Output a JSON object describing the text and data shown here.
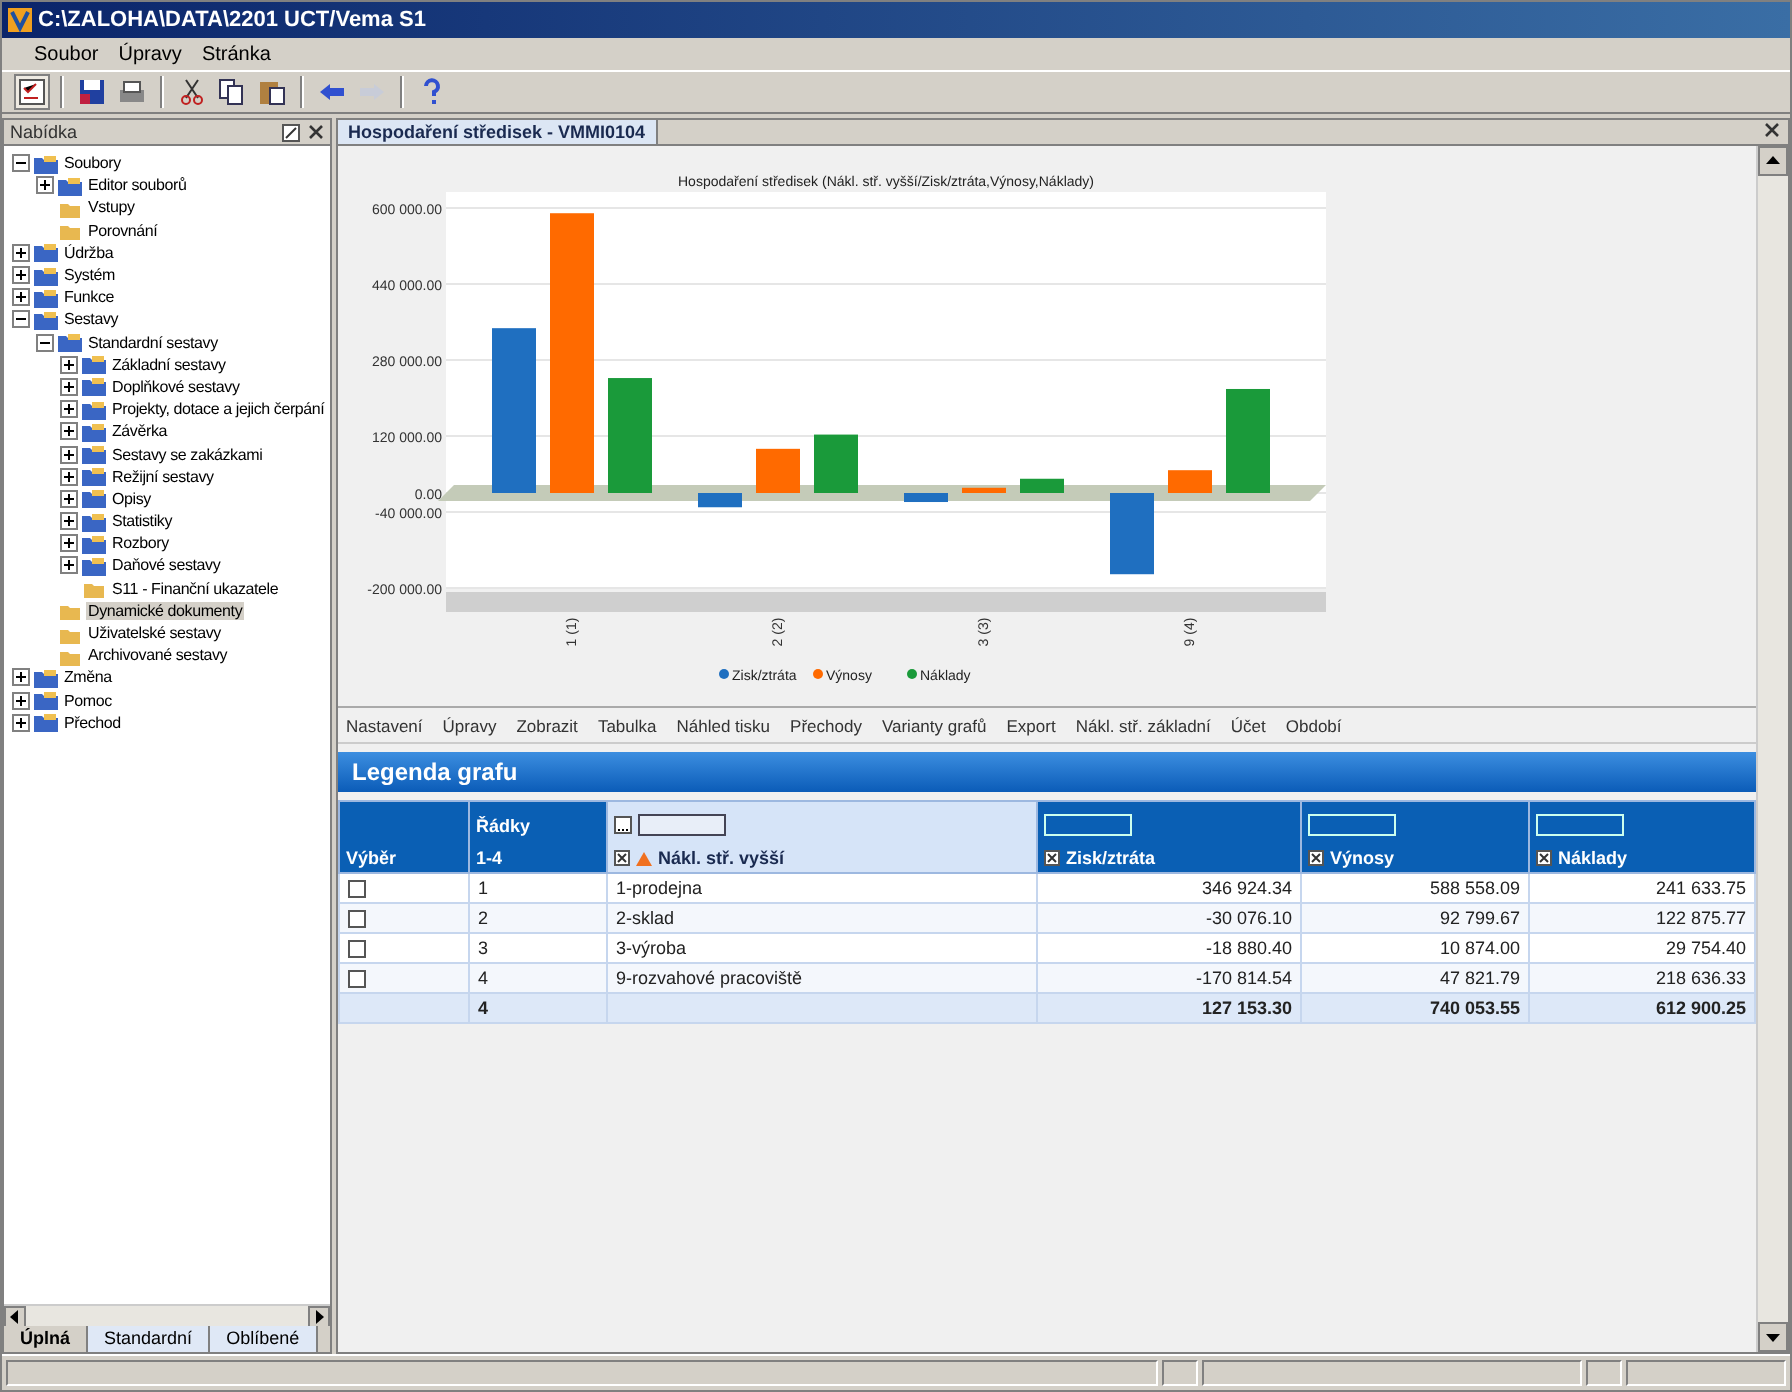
{
  "window": {
    "title": "C:\\ZALOHA\\DATA\\2201 UCT/Vema S1"
  },
  "menu": [
    "Soubor",
    "Úpravy",
    "Stránka"
  ],
  "sidebar": {
    "title": "Nabídka",
    "tree": [
      {
        "label": "Soubory",
        "expanded": true,
        "selected": false,
        "children": [
          {
            "label": "Editor souborů",
            "expanded": false,
            "selected": false
          },
          {
            "label": "Vstupy",
            "selected": false
          },
          {
            "label": "Porovnání",
            "selected": false
          }
        ]
      },
      {
        "label": "Údržba",
        "expanded": false,
        "selected": false
      },
      {
        "label": "Systém",
        "expanded": false,
        "selected": false
      },
      {
        "label": "Funkce",
        "expanded": false,
        "selected": false
      },
      {
        "label": "Sestavy",
        "expanded": true,
        "selected": false,
        "children": [
          {
            "label": "Standardní sestavy",
            "expanded": true,
            "selected": false,
            "children": [
              {
                "label": "Základní sestavy",
                "expanded": false,
                "selected": false
              },
              {
                "label": "Doplňkové sestavy",
                "expanded": false,
                "selected": false
              },
              {
                "label": "Projekty, dotace a jejich čerpání",
                "expanded": false,
                "selected": false
              },
              {
                "label": "Závěrka",
                "expanded": false,
                "selected": false
              },
              {
                "label": "Sestavy se zakázkami",
                "expanded": false,
                "selected": false
              },
              {
                "label": "Režijní sestavy",
                "expanded": false,
                "selected": false
              },
              {
                "label": "Opisy",
                "expanded": false,
                "selected": false
              },
              {
                "label": "Statistiky",
                "expanded": false,
                "selected": false
              },
              {
                "label": "Rozbory",
                "expanded": false,
                "selected": false
              },
              {
                "label": "Daňové sestavy",
                "expanded": false,
                "selected": false
              },
              {
                "label": "S11 - Finanční ukazatele",
                "selected": false
              }
            ]
          },
          {
            "label": "Dynamické dokumenty",
            "selected": true
          },
          {
            "label": "Uživatelské sestavy",
            "selected": false
          },
          {
            "label": "Archivované sestavy",
            "selected": false
          }
        ]
      },
      {
        "label": "Změna",
        "expanded": false,
        "selected": false
      },
      {
        "label": "Pomoc",
        "expanded": false,
        "selected": false
      },
      {
        "label": "Přechod",
        "expanded": false,
        "selected": false
      }
    ],
    "tabs": [
      {
        "label": "Úplná",
        "selected": true
      },
      {
        "label": "Standardní",
        "selected": false
      },
      {
        "label": "Oblíbené",
        "selected": false
      }
    ]
  },
  "document_tab": {
    "label": "Hospodaření středisek - VMMI0104",
    "selected": true
  },
  "chart": {
    "chart_data": {
      "type": "bar",
      "title": "Hospodaření středisek (Nákl. stř. vyšší/Zisk/ztráta,Výnosy,Náklady)",
      "categories": [
        "1 (1)",
        "2 (2)",
        "3 (3)",
        "9 (4)"
      ],
      "series": [
        {
          "name": "Zisk/ztráta",
          "color": "#1f6fc0",
          "values": [
            347000,
            -30000,
            -19000,
            -171000
          ]
        },
        {
          "name": "Výnosy",
          "color": "#ff6a00",
          "values": [
            589000,
            93000,
            11000,
            48000
          ]
        },
        {
          "name": "Náklady",
          "color": "#1a9a3a",
          "values": [
            242000,
            123000,
            30000,
            219000
          ]
        }
      ],
      "grid": true,
      "legend": "bottom",
      "ylim": [
        -200000,
        600000
      ],
      "yticks": [
        {
          "value": 600000,
          "label": "600 000.00"
        },
        {
          "value": 440000,
          "label": "440 000.00"
        },
        {
          "value": 280000,
          "label": "280 000.00"
        },
        {
          "value": 120000,
          "label": "120 000.00"
        },
        {
          "value": 0,
          "label": "0.00"
        },
        {
          "value": -40000,
          "label": "-40 000.00"
        },
        {
          "value": -200000,
          "label": "-200 000.00"
        }
      ]
    }
  },
  "actions": [
    "Nastavení",
    "Úpravy",
    "Zobrazit",
    "Tabulka",
    "Náhled tisku",
    "Přechody",
    "Varianty grafů",
    "Export",
    "Nákl. stř. základní",
    "Účet",
    "Období"
  ],
  "legend_table": {
    "title": "Legenda grafu",
    "columns": [
      {
        "label": "Výběr"
      },
      {
        "label": "Řádky",
        "sub": "1-4"
      },
      {
        "label": "Nákl. stř. vyšší"
      },
      {
        "label": "Zisk/ztráta"
      },
      {
        "label": "Výnosy"
      },
      {
        "label": "Náklady"
      }
    ],
    "rows": [
      {
        "checked": false,
        "cells": [
          "",
          "1",
          "1-prodejna",
          "346 924.34",
          "588 558.09",
          "241 633.75"
        ]
      },
      {
        "checked": false,
        "cells": [
          "",
          "2",
          "2-sklad",
          "-30 076.10",
          "92 799.67",
          "122 875.77"
        ]
      },
      {
        "checked": false,
        "cells": [
          "",
          "3",
          "3-výroba",
          "-18 880.40",
          "10 874.00",
          "29 754.40"
        ]
      },
      {
        "checked": false,
        "cells": [
          "",
          "4",
          "9-rozvahové pracoviště",
          "-170 814.54",
          "47 821.79",
          "218 636.33"
        ]
      }
    ],
    "total": {
      "count": "4",
      "sums": [
        "127 153.30",
        "740 053.55",
        "612 900.25"
      ]
    }
  }
}
